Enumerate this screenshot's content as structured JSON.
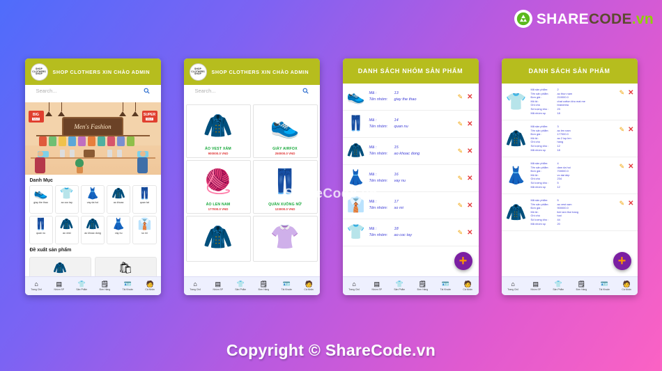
{
  "brand": {
    "part1": "SHARE",
    "part2": "CODE",
    "part3": ".vn",
    "icon": "recycle-logo-icon"
  },
  "watermarks": {
    "middle": "ShareCode.vn",
    "bottom": "Copyright © ShareCode.vn"
  },
  "background": {
    "from": "#4f6cfb",
    "to": "#fb62c4"
  },
  "accents": {
    "header_green": "#b6bd1e",
    "price_red": "#e03b3b",
    "name_green": "#17a83a",
    "field_blue": "#3b3bd6",
    "fab_purple": "#7b1fa2",
    "fab_plus": "#ff9800"
  },
  "bottom_nav": [
    {
      "label": "Trang Chủ",
      "icon": "home-icon",
      "glyph": "⌂"
    },
    {
      "label": "Nhóm SP",
      "icon": "group-icon",
      "glyph": "▤"
    },
    {
      "label": "Sản Phẩm",
      "icon": "tshirt-icon",
      "glyph": "👕"
    },
    {
      "label": "Đơn Hàng",
      "icon": "order-icon",
      "glyph": "🗒"
    },
    {
      "label": "Tài Khoản",
      "icon": "account-icon",
      "glyph": "🪪"
    },
    {
      "label": "Cá Nhân",
      "icon": "person-icon",
      "glyph": "🧑"
    }
  ],
  "phone1": {
    "header_title": "SHOP CLOTHERS XIN CHÀO ADMIN",
    "logo_text": "SHOP CLOTHERS SHOP",
    "search_placeholder": "Search...",
    "banner": {
      "sign_text": "Men's Fashion",
      "tag_left_top": "BIG",
      "tag_left_bottom": "SALE",
      "tag_right_top": "SUPER",
      "tag_right_bottom": "SALE"
    },
    "section_category": "Danh Mục",
    "section_recommend": "Đề xuất sản phẩm",
    "categories": [
      {
        "label": "giay the thao",
        "glyph": "👟"
      },
      {
        "label": "ao coc tay",
        "glyph": "👕"
      },
      {
        "label": "vay da hoi",
        "glyph": "👗"
      },
      {
        "label": "ao khoac",
        "glyph": "🧥"
      },
      {
        "label": "quan tat",
        "glyph": "👖"
      },
      {
        "label": "quan nu",
        "glyph": "👖"
      },
      {
        "label": "ao vest",
        "glyph": "🧥"
      },
      {
        "label": "ao khoac dong",
        "glyph": "🧥"
      },
      {
        "label": "vay nu",
        "glyph": "👗"
      },
      {
        "label": "so mi",
        "glyph": "👔"
      }
    ],
    "recommend": [
      {
        "glyph": "🧥"
      },
      {
        "glyph": "🛍"
      }
    ]
  },
  "phone2": {
    "header_title": "SHOP CLOTHERS XIN CHÀO ADMIN",
    "search_placeholder": "Search...",
    "products": [
      {
        "name": "ÁO VEST XÁM",
        "price": "900000.0 VND",
        "glyph": "🧥"
      },
      {
        "name": "GIÀY AIRFOX",
        "price": "250000.0 VND",
        "glyph": "👟"
      },
      {
        "name": "ÁO LEN NAM",
        "price": "177000.0 VND",
        "glyph": "🧶"
      },
      {
        "name": "QUẦN XUỒNG NỮ",
        "price": "123000.0 VND",
        "glyph": "👖"
      },
      {
        "name": "",
        "price": "",
        "glyph": "🧥"
      },
      {
        "name": "",
        "price": "",
        "glyph": "👚"
      }
    ]
  },
  "phone3": {
    "header_title": "DANH SÁCH NHÓM SẢN PHẨM",
    "label_ma": "Mã :",
    "label_ten": "Tên nhóm:",
    "edit_icon": "pencil-icon",
    "delete_icon": "x-delete-icon",
    "fab_label": "+",
    "groups": [
      {
        "ma": "13",
        "ten": "giay the thao",
        "glyph": "👟"
      },
      {
        "ma": "14",
        "ten": "quan nu",
        "glyph": "👖"
      },
      {
        "ma": "15",
        "ten": "ao khoac dong",
        "glyph": "🧥"
      },
      {
        "ma": "16",
        "ten": "vay nu",
        "glyph": "👗"
      },
      {
        "ma": "17",
        "ten": "so mi",
        "glyph": "👔"
      },
      {
        "ma": "18",
        "ten": "ao coc tay",
        "glyph": "👕"
      }
    ]
  },
  "phone4": {
    "header_title": "DANH SÁCH  SẢN PHẨM",
    "labels": {
      "ma_sp": "Mã sản phẩm:",
      "ten_sp": "Tên sản phẩm:",
      "don_gia": "Đơn giá :",
      "mo_ta": "Mô tả :",
      "ghi_chu": "Ghi chú",
      "so_luong": "Số lượng kho :",
      "ma_nhom": "Mã nhóm sp"
    },
    "edit_icon": "pencil-icon",
    "delete_icon": "x-delete-icon",
    "fab_label": "+",
    "products": [
      {
        "ma_sp": "2",
        "ten_sp": "ao thun nam",
        "don_gia": "210000.0",
        "mo_ta": "chat cotton kho mat me",
        "ghi_chu": "brandnha",
        "so_luong": "23",
        "ma_nhom": "18",
        "glyph": "👕"
      },
      {
        "ma_sp": "3",
        "ten_sp": "ao len nam",
        "don_gia": "177000.0",
        "mo_ta": "ao 2 lop len",
        "ghi_chu": "hang",
        "so_luong": "12",
        "ma_nhom": "18",
        "glyph": "🧥"
      },
      {
        "ma_sp": "4",
        "ten_sp": "dam da hoi",
        "don_gia": "700000.0",
        "mo_ta": "vo dai dep",
        "ghi_chu": "234",
        "so_luong": "5",
        "ma_nhom": "12",
        "glyph": "👗"
      },
      {
        "ma_sp": "5",
        "ten_sp": "ao vest xam",
        "don_gia": "900000.0",
        "mo_ta": "lich lam thoi trang",
        "ghi_chu": "tuoi",
        "so_luong": "44",
        "ma_nhom": "20",
        "glyph": "🧥"
      }
    ]
  }
}
